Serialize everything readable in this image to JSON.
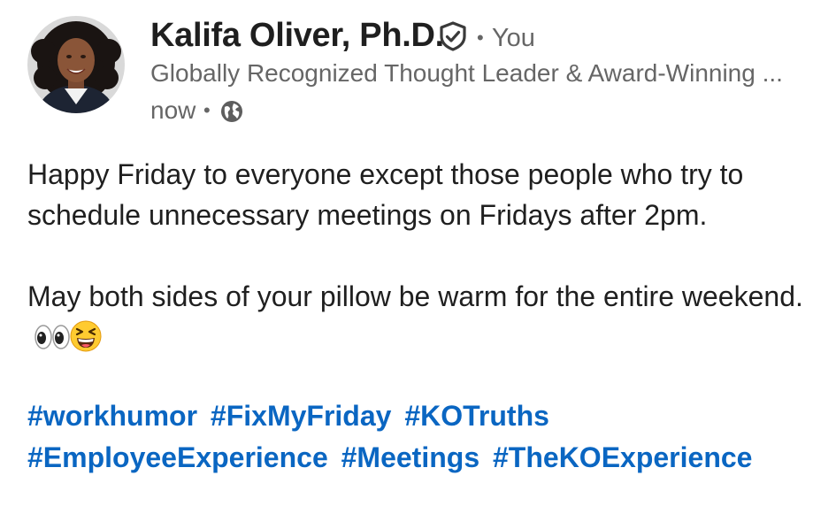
{
  "author": {
    "name": "Kalifa Oliver, Ph.D.",
    "verified_icon": "verified-shield-check-icon",
    "relation": "You",
    "separator": "•",
    "headline": "Globally Recognized Thought Leader & Award-Winning ...",
    "timestamp": "now",
    "visibility_icon": "globe-icon"
  },
  "post": {
    "paragraphs": [
      "Happy Friday to everyone except those people who try to schedule unnecessary meetings on Fridays after 2pm.",
      "May both sides of your pillow be warm for the entire weekend."
    ],
    "emojis": [
      "eyes-emoji",
      "laughing-emoji"
    ],
    "hashtags": [
      "#workhumor",
      "#FixMyFriday",
      "#KOTruths",
      "#EmployeeExperience",
      "#Meetings",
      "#TheKOExperience"
    ]
  },
  "colors": {
    "link": "#0a66c2",
    "muted": "#666666",
    "text": "#1f1f1f"
  }
}
